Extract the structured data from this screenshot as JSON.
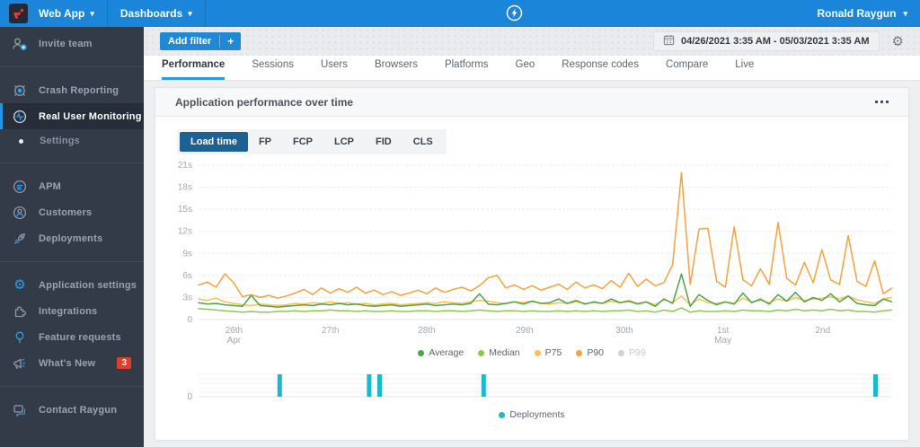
{
  "topbar": {
    "app_label": "Web App",
    "dashboards_label": "Dashboards",
    "user_label": "Ronald Raygun",
    "color": "#1b86d9"
  },
  "sidebar": {
    "bg_color": "#333b48",
    "items": [
      {
        "label": "Invite team",
        "icon": "invite-team-icon"
      },
      {
        "label": "Crash Reporting",
        "icon": "crash-reporting-icon"
      },
      {
        "label": "Real User Monitoring",
        "icon": "real-user-monitoring-icon",
        "active": true
      },
      {
        "label": "Settings",
        "icon": "bullet-icon",
        "subitem": true
      },
      {
        "label": "APM",
        "icon": "apm-icon"
      },
      {
        "label": "Customers",
        "icon": "customers-icon"
      },
      {
        "label": "Deployments",
        "icon": "deployments-icon"
      },
      {
        "label": "Application settings",
        "icon": "gear-icon"
      },
      {
        "label": "Integrations",
        "icon": "puzzle-icon"
      },
      {
        "label": "Feature requests",
        "icon": "lightbulb-icon"
      },
      {
        "label": "What's New",
        "icon": "megaphone-icon",
        "badge": "3"
      },
      {
        "label": "Contact Raygun",
        "icon": "chat-icon"
      }
    ]
  },
  "filterbar": {
    "add_filter_label": "Add filter",
    "plus_label": "+",
    "date_range": "04/26/2021 3:35 AM - 05/03/2021 3:35 AM"
  },
  "tabs": {
    "items": [
      {
        "label": "Performance",
        "active": true
      },
      {
        "label": "Sessions"
      },
      {
        "label": "Users"
      },
      {
        "label": "Browsers"
      },
      {
        "label": "Platforms"
      },
      {
        "label": "Geo"
      },
      {
        "label": "Response codes"
      },
      {
        "label": "Compare"
      },
      {
        "label": "Live"
      }
    ]
  },
  "panel": {
    "title": "Application performance over time",
    "metric_tabs": [
      {
        "label": "Load time",
        "active": true
      },
      {
        "label": "FP"
      },
      {
        "label": "FCP"
      },
      {
        "label": "LCP"
      },
      {
        "label": "FID"
      },
      {
        "label": "CLS"
      }
    ]
  },
  "chart_data": [
    {
      "type": "line",
      "title": "Application performance over time",
      "unit": "seconds",
      "ylim": [
        0,
        21
      ],
      "ytick_step": 3,
      "yticks": [
        "0",
        "3s",
        "6s",
        "9s",
        "12s",
        "15s",
        "18s",
        "21s"
      ],
      "grid": true,
      "legend_position": "bottom",
      "xticks": [
        {
          "label": "26th",
          "sub": "Apr",
          "pos": 5.1
        },
        {
          "label": "27th",
          "pos": 19.0
        },
        {
          "label": "28th",
          "pos": 32.9
        },
        {
          "label": "29th",
          "pos": 47.0
        },
        {
          "label": "30th",
          "pos": 61.4
        },
        {
          "label": "1st",
          "sub": "May",
          "pos": 75.6
        },
        {
          "label": "2nd",
          "pos": 90.0
        }
      ],
      "series": [
        {
          "name": "Average",
          "color": "#4ba446",
          "values": [
            2.3,
            2.1,
            2.2,
            2.0,
            1.9,
            1.8,
            3.3,
            1.9,
            1.8,
            1.7,
            1.8,
            1.9,
            2.0,
            1.9,
            2.1,
            2.0,
            2.2,
            2.0,
            2.1,
            1.9,
            1.8,
            1.9,
            2.0,
            1.8,
            1.9,
            2.0,
            2.1,
            1.9,
            2.0,
            2.1,
            2.0,
            2.2,
            3.5,
            2.1,
            2.0,
            2.2,
            2.4,
            2.1,
            2.5,
            2.2,
            2.3,
            2.8,
            2.2,
            2.6,
            2.1,
            2.4,
            2.2,
            2.8,
            2.3,
            2.5,
            2.1,
            2.4,
            1.8,
            2.8,
            2.2,
            6.2,
            1.8,
            3.4,
            2.6,
            2.0,
            2.4,
            2.1,
            3.6,
            2.3,
            2.8,
            2.1,
            3.4,
            2.5,
            3.7,
            2.4,
            3.0,
            2.6,
            3.5,
            2.4,
            3.2,
            2.2,
            2.0,
            1.9,
            2.8,
            2.4
          ]
        },
        {
          "name": "Median",
          "color": "#8fc653",
          "values": [
            1.5,
            1.4,
            1.3,
            1.2,
            1.1,
            1.0,
            1.1,
            1.0,
            1.0,
            1.1,
            1.1,
            1.2,
            1.1,
            1.2,
            1.2,
            1.3,
            1.2,
            1.2,
            1.1,
            1.2,
            1.1,
            1.1,
            1.2,
            1.1,
            1.1,
            1.2,
            1.2,
            1.1,
            1.2,
            1.2,
            1.1,
            1.2,
            1.3,
            1.2,
            1.1,
            1.2,
            1.2,
            1.1,
            1.2,
            1.1,
            1.1,
            1.2,
            1.1,
            1.2,
            1.1,
            1.2,
            1.1,
            1.2,
            1.2,
            1.3,
            1.1,
            1.2,
            1.0,
            1.3,
            1.1,
            1.6,
            1.0,
            1.2,
            1.1,
            1.1,
            1.2,
            1.1,
            1.3,
            1.2,
            1.2,
            1.1,
            1.3,
            1.2,
            1.4,
            1.2,
            1.3,
            1.2,
            1.4,
            1.2,
            1.3,
            1.1,
            1.1,
            1.0,
            1.2,
            1.3
          ]
        },
        {
          "name": "P75",
          "color": "#fbc04d",
          "values": [
            2.8,
            2.6,
            2.9,
            2.4,
            2.2,
            2.0,
            1.9,
            2.1,
            2.0,
            1.9,
            2.0,
            2.2,
            2.1,
            2.3,
            2.2,
            2.4,
            2.2,
            2.3,
            2.1,
            2.2,
            2.0,
            2.1,
            2.2,
            2.0,
            2.1,
            2.2,
            2.3,
            2.2,
            2.4,
            2.3,
            2.2,
            2.4,
            2.6,
            2.5,
            2.3,
            2.2,
            2.4,
            2.3,
            2.5,
            2.2,
            2.1,
            2.3,
            2.2,
            2.4,
            2.2,
            2.3,
            2.2,
            2.5,
            2.3,
            2.6,
            2.2,
            2.4,
            2.0,
            2.7,
            2.3,
            3.2,
            2.0,
            2.8,
            2.3,
            2.2,
            2.4,
            2.2,
            2.9,
            2.4,
            2.6,
            2.3,
            2.8,
            2.5,
            3.0,
            2.6,
            2.8,
            2.9,
            3.1,
            2.8,
            3.2,
            2.7,
            2.4,
            2.2,
            2.8,
            3.0
          ]
        },
        {
          "name": "P90",
          "color": "#f9a13c",
          "values": [
            4.7,
            5.1,
            4.4,
            6.2,
            5.0,
            3.1,
            3.4,
            3.0,
            3.3,
            2.9,
            3.2,
            3.6,
            4.1,
            3.4,
            4.3,
            3.6,
            4.2,
            3.7,
            4.4,
            3.6,
            4.0,
            3.4,
            3.8,
            3.3,
            3.6,
            4.0,
            3.5,
            4.3,
            3.7,
            4.1,
            4.4,
            3.9,
            4.6,
            5.7,
            6.0,
            4.3,
            4.7,
            4.1,
            4.6,
            4.0,
            4.4,
            4.8,
            4.1,
            5.1,
            4.3,
            4.7,
            4.2,
            5.3,
            4.4,
            6.3,
            4.5,
            5.5,
            4.6,
            5.0,
            7.5,
            20.0,
            4.8,
            12.3,
            12.4,
            5.2,
            4.4,
            12.6,
            5.4,
            4.6,
            6.9,
            4.8,
            13.2,
            5.6,
            4.7,
            7.8,
            5.0,
            9.5,
            5.4,
            4.8,
            11.4,
            5.2,
            4.5,
            8.0,
            3.5,
            4.3
          ]
        },
        {
          "name": "P99",
          "color": "#cdd2d8",
          "disabled": true,
          "values": []
        }
      ]
    },
    {
      "type": "bar",
      "name": "Deployments",
      "color": "#19b9d0",
      "ytick": "0",
      "legend_label": "Deployments",
      "bars": [
        {
          "pos": 11.7
        },
        {
          "pos": 24.6
        },
        {
          "pos": 26.1
        },
        {
          "pos": 41.1
        },
        {
          "pos": 97.6
        }
      ]
    }
  ]
}
